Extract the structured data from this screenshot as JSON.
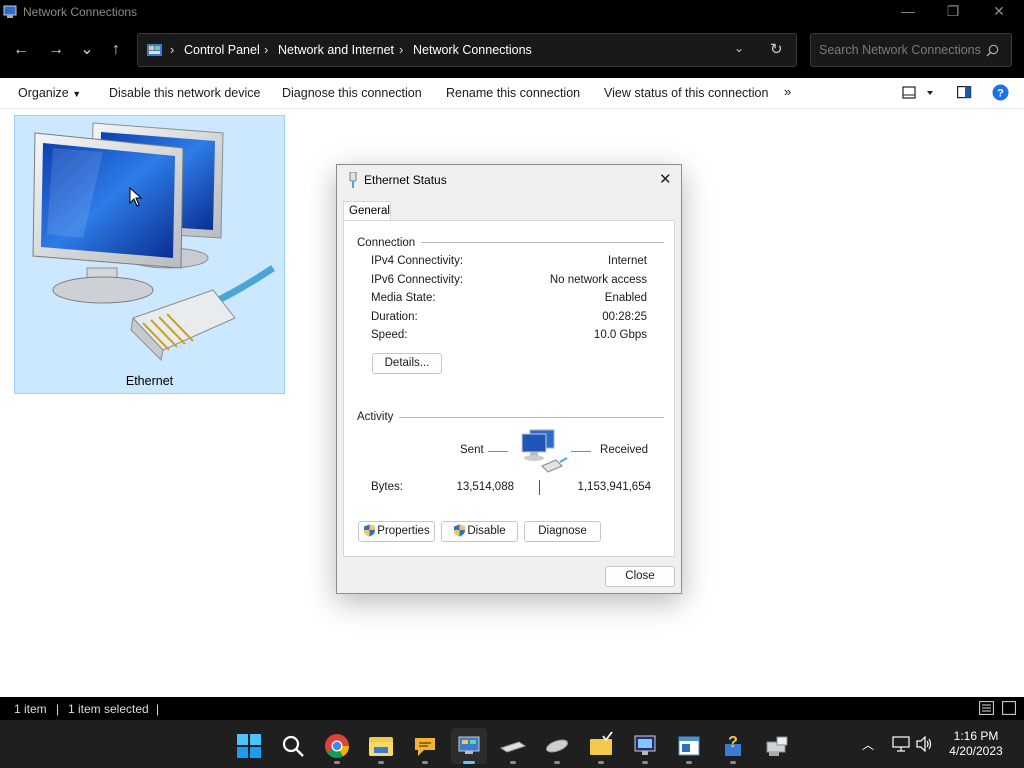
{
  "window": {
    "title": "Network Connections",
    "minimize": "—",
    "maximize": "❐",
    "close": "✕"
  },
  "nav": {
    "back": "←",
    "forward": "→",
    "recent": "⌄",
    "up": "↑",
    "breadcrumb": [
      "Control Panel",
      "Network and Internet",
      "Network Connections"
    ],
    "separator": "›",
    "dropdown": "⌄",
    "refresh": "↻",
    "search_placeholder": "Search Network Connections"
  },
  "commands": {
    "organize": "Organize",
    "disable": "Disable this network device",
    "diagnose": "Diagnose this connection",
    "rename": "Rename this connection",
    "view_status": "View status of this connection",
    "more": "»"
  },
  "items": [
    {
      "label": "Ethernet"
    }
  ],
  "dialog": {
    "title": "Ethernet Status",
    "close": "✕",
    "tab": "General",
    "connection_label": "Connection",
    "rows": [
      {
        "label": "IPv4 Connectivity:",
        "value": "Internet"
      },
      {
        "label": "IPv6 Connectivity:",
        "value": "No network access"
      },
      {
        "label": "Media State:",
        "value": "Enabled"
      },
      {
        "label": "Duration:",
        "value": "00:28:25"
      },
      {
        "label": "Speed:",
        "value": "10.0 Gbps"
      }
    ],
    "details_button": "Details...",
    "activity_label": "Activity",
    "sent_label": "Sent",
    "received_label": "Received",
    "bytes_label": "Bytes:",
    "bytes_sent": "13,514,088",
    "bytes_received": "1,153,941,654",
    "properties_button": "Properties",
    "disable_button": "Disable",
    "diagnose_button": "Diagnose",
    "close_button": "Close"
  },
  "status": {
    "count": "1 item",
    "selected": "1 item selected",
    "sep": "|"
  },
  "taskbar": {
    "apps": [
      "start-icon",
      "search-icon",
      "chrome-icon",
      "file-explorer-icon",
      "feedback-icon",
      "network-connections-icon",
      "eraser-icon",
      "mouse-icon",
      "folder-check-icon",
      "display-icon",
      "window-app-icon",
      "help-icon",
      "network-printer-icon"
    ],
    "time": "1:16 PM",
    "date": "4/20/2023"
  },
  "colors": {
    "accent": "#0078d4",
    "selection": "#cce8ff",
    "dark": "#000000"
  }
}
